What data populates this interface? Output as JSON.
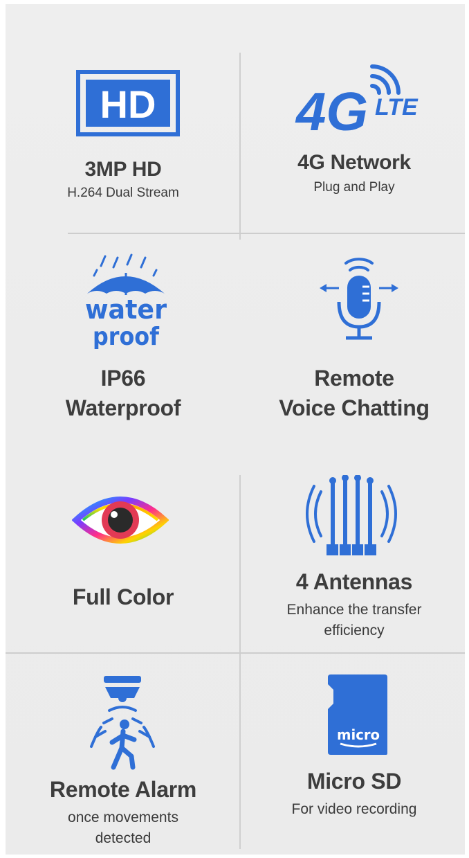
{
  "accent_color": "#2f6fd6",
  "features": [
    {
      "icon": "hd-icon",
      "title": "3MP HD",
      "subtitle": "H.264 Dual Stream"
    },
    {
      "icon": "4g-lte-icon",
      "badge_main": "4G",
      "badge_sub": "LTE",
      "title": "4G Network",
      "subtitle": "Plug and Play"
    },
    {
      "icon": "waterproof-umbrella-icon",
      "badge_line1": "water",
      "badge_line2": "proof",
      "title": "IP66",
      "title2": "Waterproof"
    },
    {
      "icon": "microphone-icon",
      "title": "Remote",
      "title2": "Voice Chatting"
    },
    {
      "icon": "color-eye-icon",
      "title": "Full Color"
    },
    {
      "icon": "antennas-icon",
      "title": "4 Antennas",
      "subtitle": "Enhance the transfer",
      "subtitle2": "efficiency"
    },
    {
      "icon": "motion-alarm-icon",
      "title": "Remote Alarm",
      "subtitle": "once movements",
      "subtitle2": "detected"
    },
    {
      "icon": "micro-sd-icon",
      "badge_text": "micro",
      "title": "Micro SD",
      "subtitle": "For video recording"
    }
  ],
  "hd_badge_text": "HD"
}
